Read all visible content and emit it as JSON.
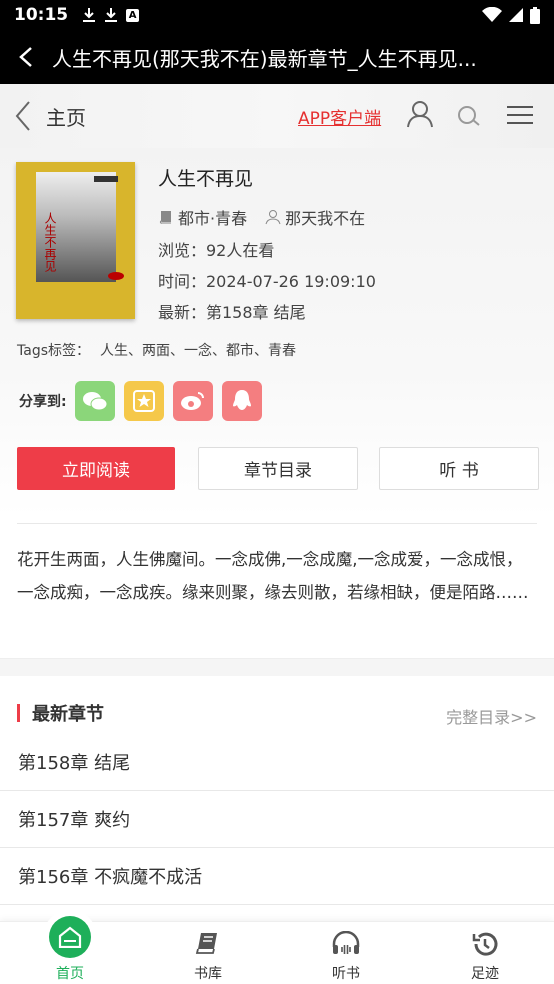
{
  "status_bar": {
    "time": "10:15",
    "a_icon": "A"
  },
  "app_bar": {
    "title": "人生不再见(那天我不在)最新章节_人生不再见..."
  },
  "header": {
    "home_label": "主页",
    "app_link": "APP客户端"
  },
  "book": {
    "title": "人生不再见",
    "category": "都市·青春",
    "author": "那天我不在",
    "views": "浏览：92人在看",
    "time": "时间：2024-07-26 19:09:10",
    "latest": "最新：第158章 结尾",
    "cover_text": "人生不再见",
    "tags_label": "Tags标签：",
    "tags": "人生、两面、一念、都市、青春"
  },
  "share": {
    "label": "分享到:"
  },
  "buttons": {
    "read": "立即阅读",
    "catalog": "章节目录",
    "listen": "听 书"
  },
  "description": "花开生两面，人生佛魔间。一念成佛,一念成魔,一念成爱，一念成恨，一念成痴，一念成疾。缘来则聚，缘去则散，若缘相缺，便是陌路……",
  "latest_section": {
    "title": "最新章节",
    "more": "完整目录>>",
    "chapters": [
      "第158章 结尾",
      "第157章 爽约",
      "第156章 不疯魔不成活"
    ]
  },
  "bottom_nav": [
    {
      "label": "首页",
      "icon": "home-icon"
    },
    {
      "label": "书库",
      "icon": "book-icon"
    },
    {
      "label": "听书",
      "icon": "headphones-icon"
    },
    {
      "label": "足迹",
      "icon": "history-icon"
    }
  ],
  "colors": {
    "accent": "#ee3d48",
    "nav_active": "#1eaf5a",
    "link": "#e53030"
  }
}
